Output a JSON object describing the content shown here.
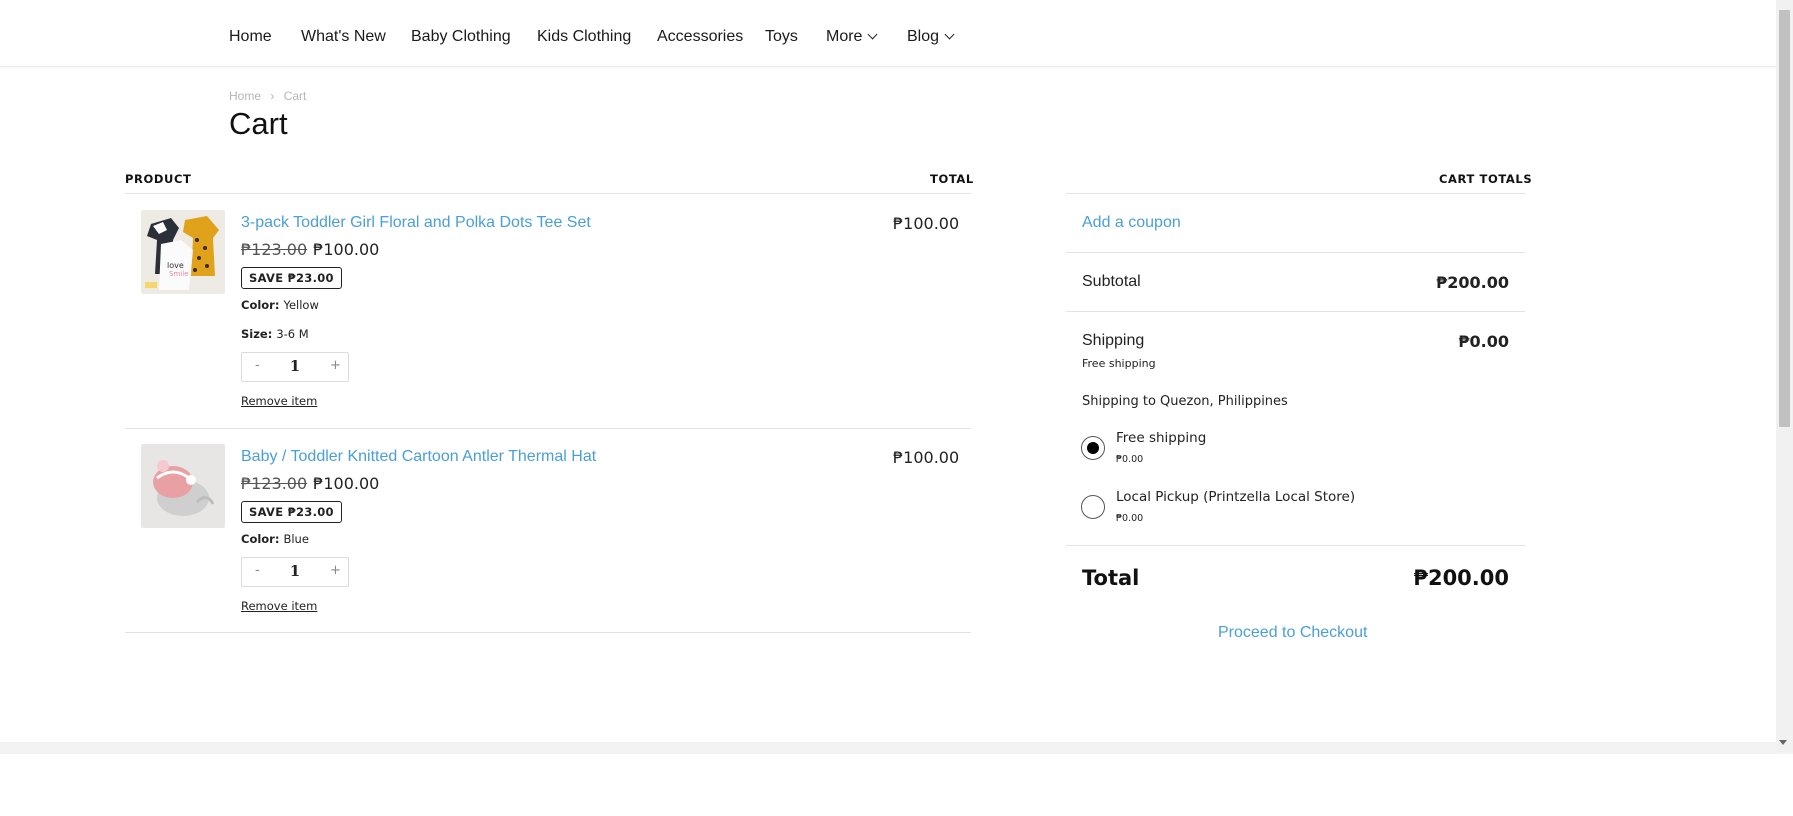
{
  "nav": {
    "items": [
      "Home",
      "What's New",
      "Baby Clothing",
      "Kids Clothing",
      "Accessories",
      "Toys",
      "More",
      "Blog"
    ]
  },
  "breadcrumb": {
    "home": "Home",
    "sep": "›",
    "current": "Cart"
  },
  "page_title": "Cart",
  "table": {
    "product_header": "PRODUCT",
    "total_header": "TOTAL"
  },
  "items": [
    {
      "name": "3-pack Toddler Girl Floral and Polka Dots Tee Set",
      "old_price": "₱123.00",
      "price": "₱100.00",
      "save": "SAVE ₱23.00",
      "color_label": "Color:",
      "color": "Yellow",
      "size_label": "Size:",
      "size": "3-6 M",
      "qty": "1",
      "minus": "-",
      "plus": "+",
      "remove": "Remove item",
      "line_total": "₱100.00"
    },
    {
      "name": "Baby / Toddler Knitted Cartoon Antler Thermal Hat",
      "old_price": "₱123.00",
      "price": "₱100.00",
      "save": "SAVE ₱23.00",
      "color_label": "Color:",
      "color": "Blue",
      "qty": "1",
      "minus": "-",
      "plus": "+",
      "remove": "Remove item",
      "line_total": "₱100.00"
    }
  ],
  "totals": {
    "header": "CART TOTALS",
    "coupon": "Add a coupon",
    "subtotal_label": "Subtotal",
    "subtotal": "₱200.00",
    "shipping_label": "Shipping",
    "shipping": "₱0.00",
    "shipping_method": "Free shipping",
    "shipping_to": "Shipping to Quezon, Philippines",
    "options": [
      {
        "label": "Free shipping",
        "price": "₱0.00",
        "selected": true
      },
      {
        "label": "Local Pickup (Printzella Local Store)",
        "price": "₱0.00",
        "selected": false
      }
    ],
    "total_label": "Total",
    "total": "₱200.00",
    "checkout": "Proceed to Checkout"
  },
  "colors": {
    "link": "#4a9fd8",
    "text": "#222222",
    "rule": "#e3e3e3"
  }
}
